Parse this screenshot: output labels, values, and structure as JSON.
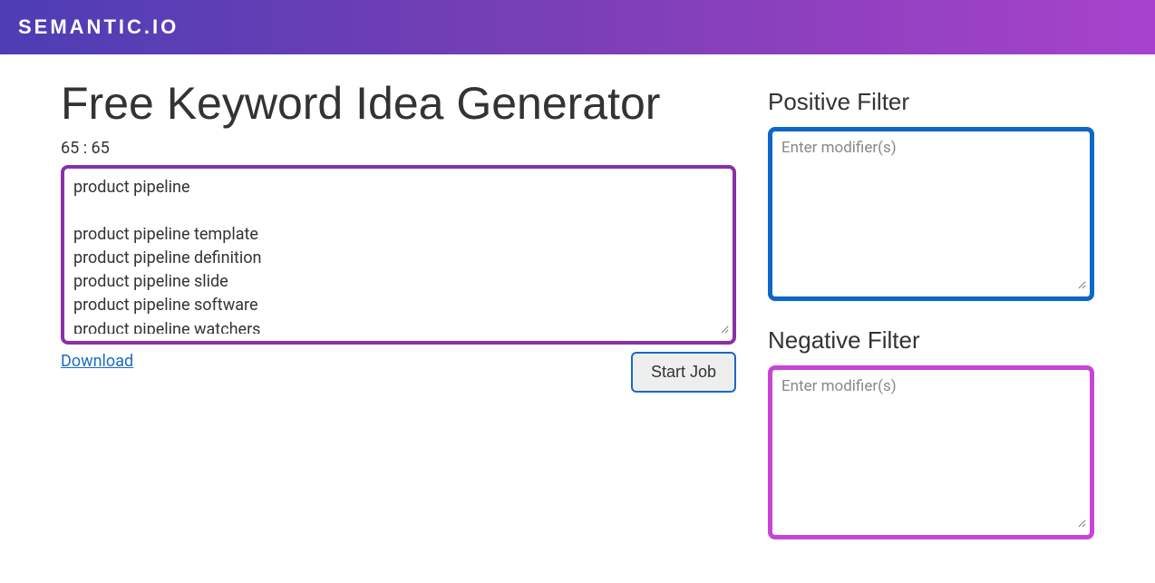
{
  "header": {
    "logo": "SEMANTIC.IO"
  },
  "main": {
    "title": "Free Keyword Idea Generator",
    "count": "65 : 65",
    "results": "product pipeline\n\nproduct pipeline template\nproduct pipeline definition\nproduct pipeline slide\nproduct pipeline software\nproduct pipeline watchers",
    "download_label": "Download",
    "start_label": "Start Job"
  },
  "sidebar": {
    "positive": {
      "title": "Positive Filter",
      "placeholder": "Enter modifier(s)",
      "value": ""
    },
    "negative": {
      "title": "Negative Filter",
      "placeholder": "Enter modifier(s)",
      "value": ""
    }
  }
}
